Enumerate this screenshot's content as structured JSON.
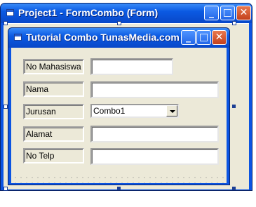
{
  "outer_window": {
    "title": "Project1 - FormCombo (Form)",
    "minimize": "_",
    "maximize": "□",
    "close": "✕"
  },
  "inner_window": {
    "title": "Tutorial Combo TunasMedia.com",
    "minimize": "_",
    "maximize": "□",
    "close": "✕"
  },
  "form": {
    "fields": [
      {
        "label": "No Mahasiswa",
        "value": ""
      },
      {
        "label": "Nama",
        "value": ""
      },
      {
        "label": "Jurusan",
        "value": "Combo1"
      },
      {
        "label": "Alamat",
        "value": ""
      },
      {
        "label": "No Telp",
        "value": ""
      }
    ]
  },
  "colors": {
    "title_bar": "#0b54e2",
    "client": "#ece9d8",
    "close_button": "#c4401c"
  },
  "icons": [
    "form-icon",
    "minimize-icon",
    "maximize-icon",
    "close-icon",
    "dropdown-arrow-icon"
  ]
}
